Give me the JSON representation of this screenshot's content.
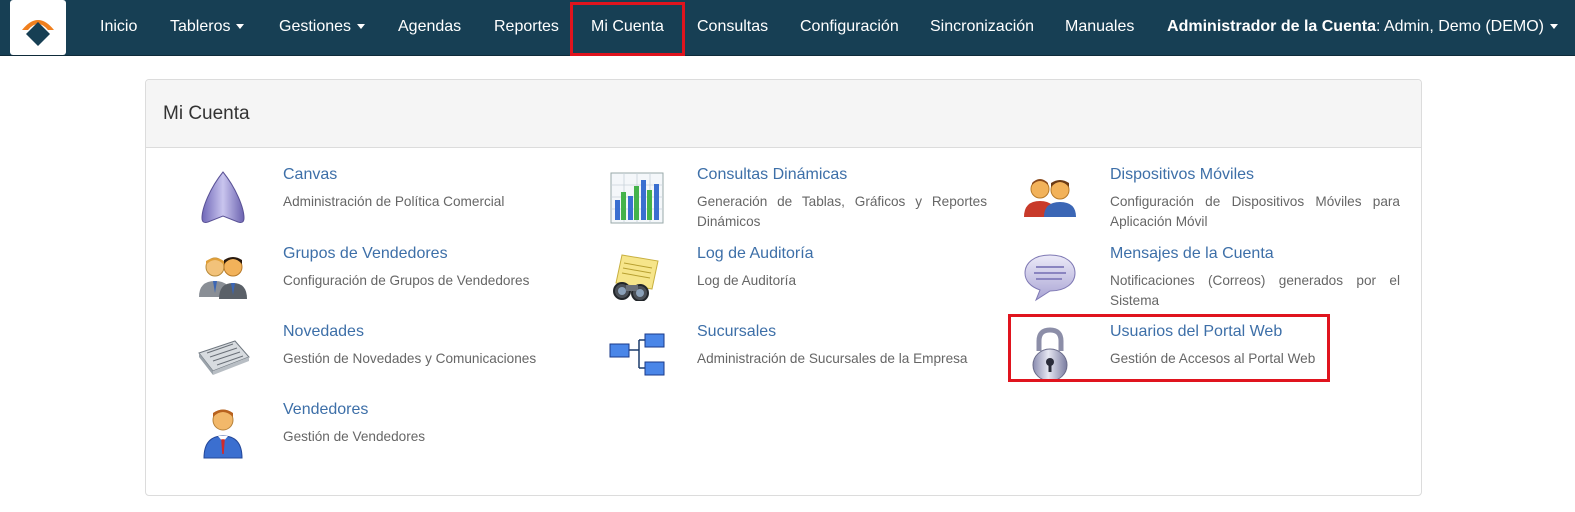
{
  "nav": {
    "logo": "logo-icon",
    "items": [
      {
        "label": "Inicio"
      },
      {
        "label": "Tableros"
      },
      {
        "label": "Gestiones"
      },
      {
        "label": "Agendas"
      },
      {
        "label": "Reportes"
      },
      {
        "label": "Mi Cuenta"
      },
      {
        "label": "Consultas"
      },
      {
        "label": "Configuración"
      },
      {
        "label": "Sincronización"
      },
      {
        "label": "Manuales"
      }
    ],
    "user_role": "Administrador de la Cuenta",
    "user_name": ": Admin, Demo (DEMO)"
  },
  "panel": {
    "title": "Mi Cuenta",
    "items": [
      {
        "title": "Canvas",
        "desc": "Administración de Política Comercial",
        "icon": "canvas-icon"
      },
      {
        "title": "Consultas Dinámicas",
        "desc": "Generación de Tablas, Gráficos y Reportes Dinámicos",
        "icon": "bar-chart-icon"
      },
      {
        "title": "Dispositivos Móviles",
        "desc": "Configuración de Dispositivos Móviles para Aplicación Móvil",
        "icon": "users-icon"
      },
      {
        "title": "Grupos de Vendedores",
        "desc": "Configuración de Grupos de Vendedores",
        "icon": "group-icon"
      },
      {
        "title": "Log de Auditoría",
        "desc": "Log de Auditoría",
        "icon": "binoculars-icon"
      },
      {
        "title": "Mensajes de la Cuenta",
        "desc": "Notificaciones (Correos) generados por el Sistema",
        "icon": "speech-bubble-icon"
      },
      {
        "title": "Novedades",
        "desc": "Gestión de Novedades y Comunicaciones",
        "icon": "newspaper-icon"
      },
      {
        "title": "Sucursales",
        "desc": "Administración de Sucursales de la Empresa",
        "icon": "org-chart-icon"
      },
      {
        "title": "Usuarios del Portal Web",
        "desc": "Gestión de Accesos al Portal Web",
        "icon": "padlock-icon"
      },
      {
        "title": "Vendedores",
        "desc": "Gestión de Vendedores",
        "icon": "person-icon"
      }
    ]
  },
  "colors": {
    "navbar": "#173f54",
    "link": "#3d6fa8",
    "highlight": "#e0141e"
  }
}
